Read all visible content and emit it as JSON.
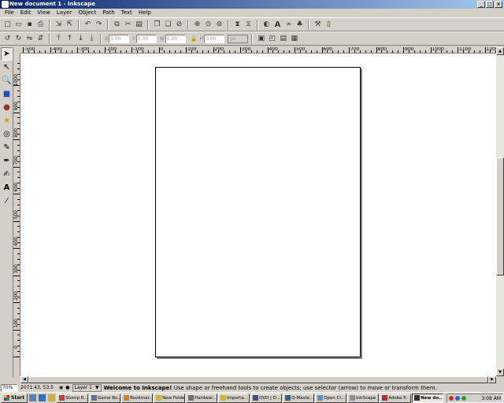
{
  "window": {
    "title": "New document 1 - Inkscape"
  },
  "menubar": [
    "File",
    "Edit",
    "View",
    "Layer",
    "Object",
    "Path",
    "Text",
    "Help"
  ],
  "toolbar1": {
    "icons": [
      "new-icon",
      "open-icon",
      "save-icon",
      "print-icon",
      "sep",
      "import-icon",
      "export-icon",
      "sep",
      "undo-icon",
      "redo-icon",
      "sep",
      "copy-icon",
      "cut-icon",
      "paste-icon",
      "sep",
      "duplicate-icon",
      "clone-icon",
      "unlink-clone-icon",
      "sep",
      "zoom-selection-icon",
      "zoom-drawing-icon",
      "zoom-page-icon",
      "sep",
      "group-icon",
      "ungroup-icon",
      "sep",
      "fill-stroke-icon",
      "text-font-icon",
      "xml-editor-icon",
      "align-icon",
      "sep",
      "preferences-icon",
      "document-properties-icon"
    ]
  },
  "toolbar2": {
    "x_label": "X",
    "x_value": "0.00",
    "y_label": "Y",
    "y_value": "0.00",
    "w_label": "W",
    "w_value": "0.00",
    "h_label": "H",
    "h_value": "0.00",
    "unit": "px"
  },
  "tools": [
    "selector",
    "node",
    "zoom",
    "rectangle",
    "ellipse",
    "star",
    "spiral",
    "pencil",
    "pen",
    "calligraphy",
    "text",
    "dropper"
  ],
  "ruler": {
    "h_labels": [
      "-500",
      "-400",
      "-300",
      "-200",
      "-100",
      "0",
      "100",
      "200",
      "300",
      "400",
      "500",
      "600",
      "700",
      "800",
      "900",
      "1000",
      "1100",
      "1200"
    ],
    "v_labels": [
      "0",
      "100",
      "200",
      "300",
      "400",
      "500",
      "600",
      "700",
      "800",
      "900",
      "1000"
    ]
  },
  "status": {
    "zoom": "70%",
    "coords": "2071.43, 53.5",
    "layer": "Layer 1",
    "message_bold": "Welcome to Inkscape!",
    "message": " Use shape or freehand tools to create objects; use selector (arrow) to move or transform them."
  },
  "taskbar": {
    "start": "Start",
    "tasks": [
      "Stomp R...",
      "Game Bo...",
      "Bookmar...",
      "New Folder",
      "Hardwar...",
      "Importa...",
      "DVD | D...",
      "Q-Maste...",
      "Open Cl...",
      "InkScape",
      "Adobe P...",
      "New do..."
    ],
    "active_task": 11,
    "clock": "3:08 AM"
  }
}
